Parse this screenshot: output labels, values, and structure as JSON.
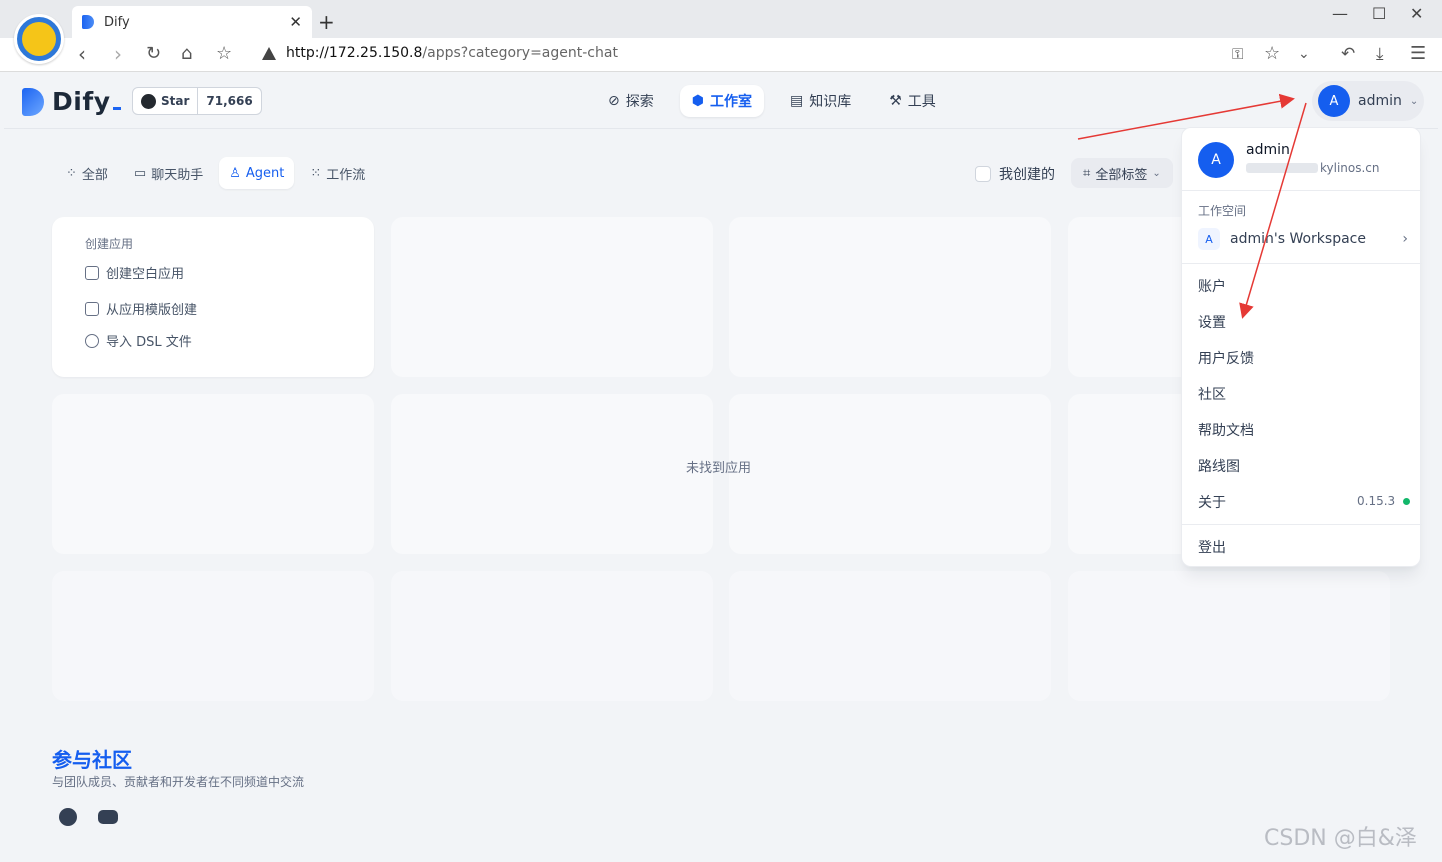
{
  "browser": {
    "tab_title": "Dify",
    "tab_close": "✕",
    "new_tab": "+",
    "url_host": "http://172.25.150.8",
    "url_rest": "/apps?category=agent-chat",
    "window_controls": [
      "—",
      "☐",
      "✕"
    ]
  },
  "header": {
    "logo": "Dify",
    "star_label": "Star",
    "star_count": "71,666",
    "nav": [
      {
        "label": "探索",
        "icon": "explore-icon"
      },
      {
        "label": "工作室",
        "icon": "robot-icon",
        "active": true
      },
      {
        "label": "知识库",
        "icon": "book-icon"
      },
      {
        "label": "工具",
        "icon": "tool-icon"
      }
    ],
    "user": {
      "avatar": "A",
      "name": "admin"
    }
  },
  "filters": {
    "tabs": [
      {
        "label": "全部",
        "icon": "grid-icon"
      },
      {
        "label": "聊天助手",
        "icon": "chat-icon"
      },
      {
        "label": "Agent",
        "icon": "agent-icon",
        "active": true
      },
      {
        "label": "工作流",
        "icon": "workflow-icon"
      }
    ],
    "mine_label": "我创建的",
    "tags_label": "全部标签"
  },
  "create_card": {
    "title": "创建应用",
    "items": [
      "创建空白应用",
      "从应用模版创建",
      "导入 DSL 文件"
    ]
  },
  "empty_text": "未找到应用",
  "footer": {
    "title": "参与社区",
    "subtitle": "与团队成员、贡献者和开发者在不同频道中交流"
  },
  "watermark": "CSDN @白&泽",
  "dropdown": {
    "avatar": "A",
    "name": "admin",
    "email_suffix": "kylinos.cn",
    "workspace_label": "工作空间",
    "workspace_badge": "A",
    "workspace_name": "admin's Workspace",
    "items": [
      "账户",
      "设置",
      "用户反馈",
      "社区",
      "帮助文档",
      "路线图",
      "关于"
    ],
    "version": "0.15.3",
    "logout": "登出"
  },
  "colors": {
    "accent": "#155eef",
    "status_ok": "#12b76a",
    "annotation": "#e53935"
  }
}
